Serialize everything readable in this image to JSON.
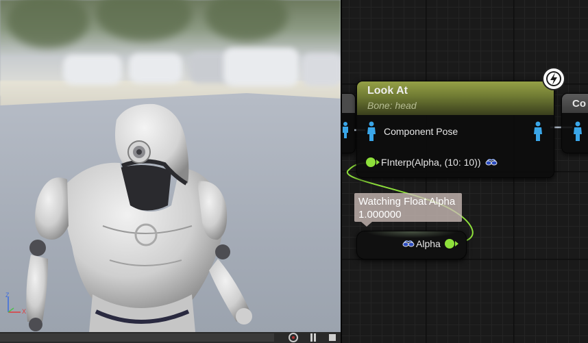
{
  "graph": {
    "look_at_node": {
      "title": "Look At",
      "subtitle": "Bone: head",
      "pins": {
        "component_pose": "Component Pose",
        "alpha": "FInterp(Alpha, (10: 10))"
      },
      "header_color": "#8e9a42",
      "fast_path_icon": "lightning-bolt-icon"
    },
    "right_node": {
      "title": "Co"
    },
    "watch": {
      "label": "Watching Float Alpha",
      "value": "1.000000"
    },
    "alpha_getter": {
      "label": "Alpha"
    },
    "pin_color_float": "#8ee03b",
    "pose_pin_color": "#3aa6e8"
  },
  "viewport": {
    "axis_labels": {
      "x": "X",
      "z": "Z"
    },
    "axis_colors": {
      "x": "#e03a3a",
      "z": "#3a6be0"
    }
  }
}
